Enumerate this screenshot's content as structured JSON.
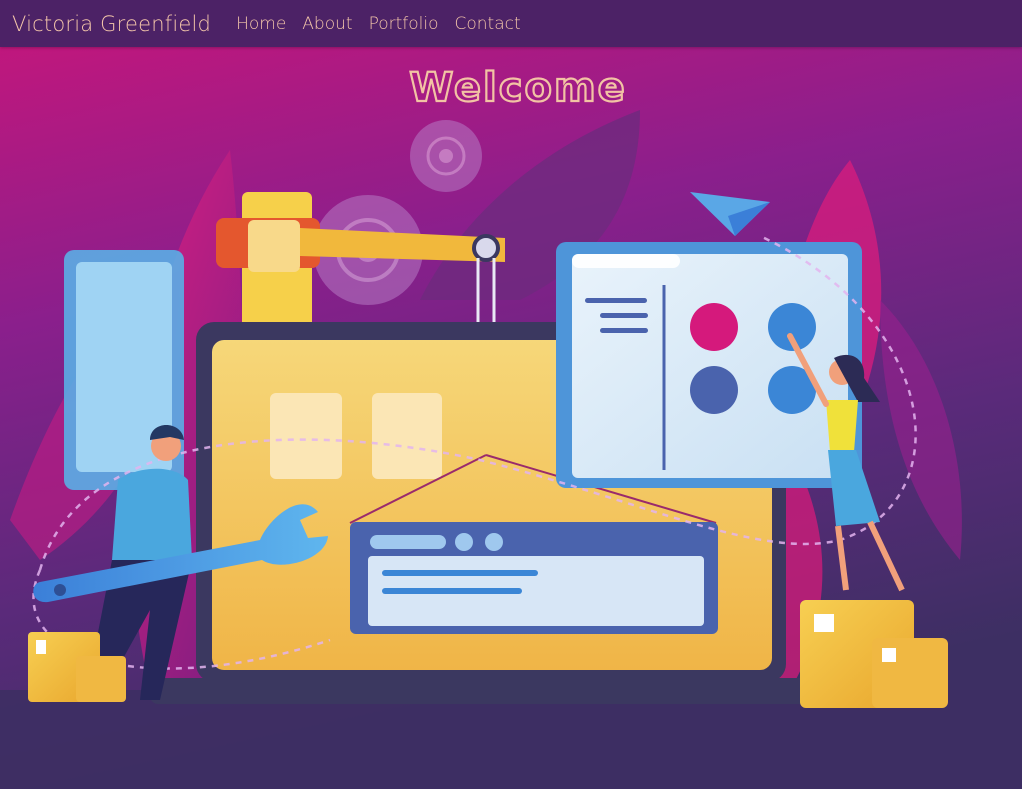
{
  "nav": {
    "brand": "Victoria Greenfield",
    "links": [
      "Home",
      "About",
      "Portfolio",
      "Contact"
    ]
  },
  "hero": {
    "heading": "Welcome",
    "illustration": "web-development-construction-illustration"
  },
  "colors": {
    "navbar": "#4c2266",
    "nav_text": "#f4c6aa",
    "heading_text": "#f2c3a4",
    "bg_top": "#c0177d",
    "bg_bottom": "#3d2f63"
  }
}
